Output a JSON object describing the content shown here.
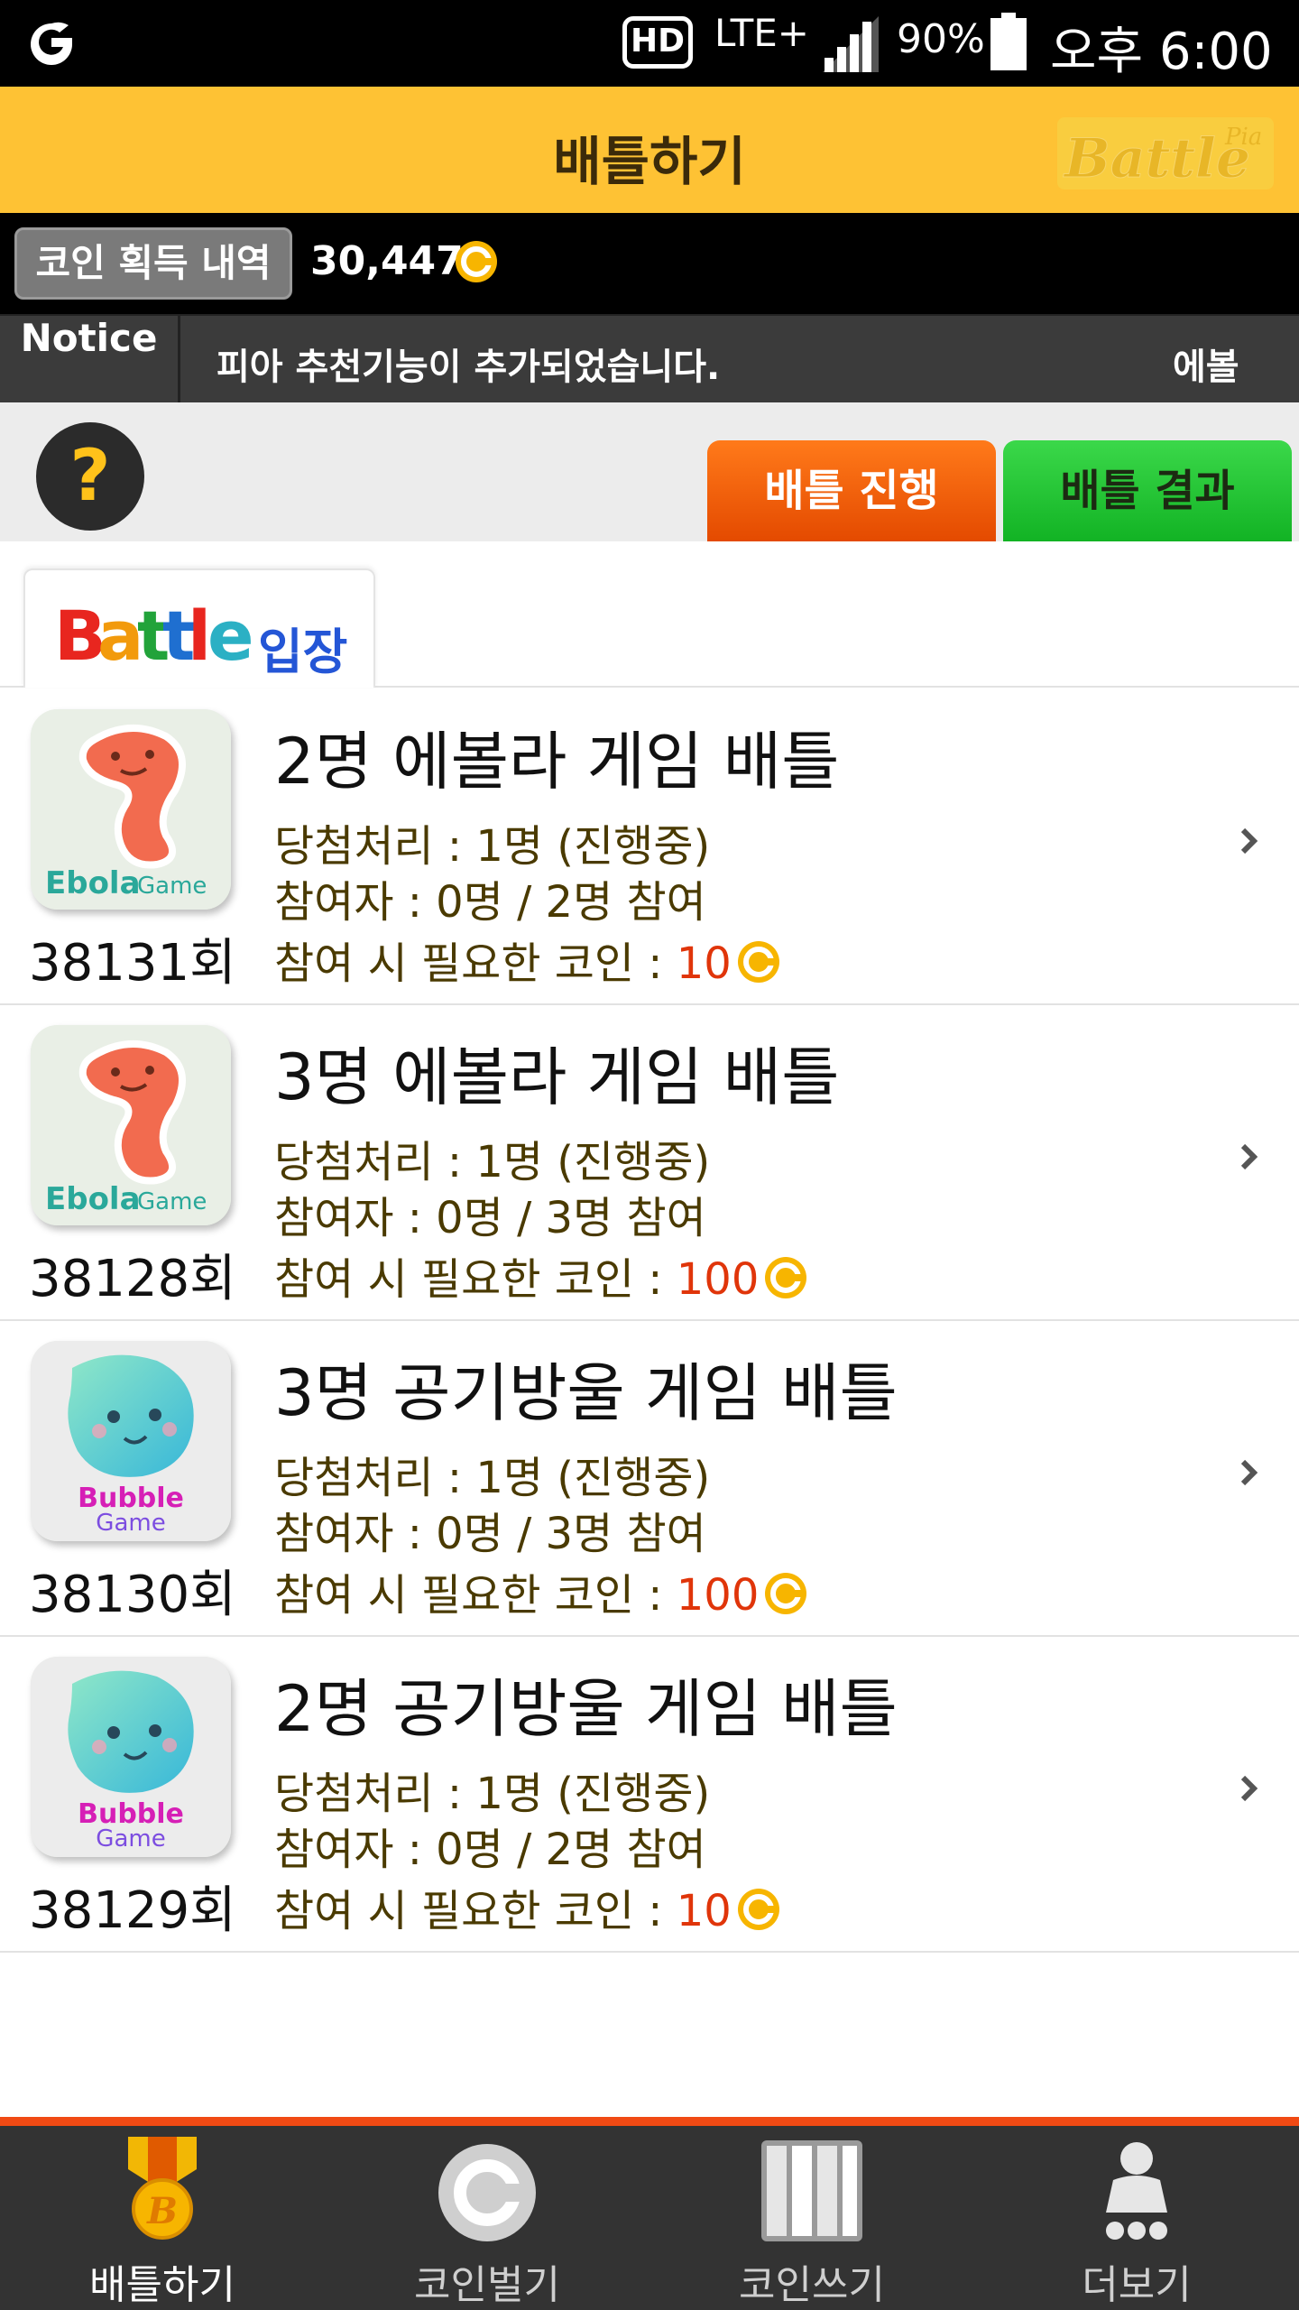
{
  "status_bar": {
    "hd": "HD",
    "network": "LTE+",
    "battery_percent": "90%",
    "time": "오후 6:00"
  },
  "header": {
    "title": "배틀하기",
    "logo_text": "Battle",
    "logo_sup": "Pia"
  },
  "coins": {
    "history_label": "코인 획득 내역",
    "amount": "30,447"
  },
  "notice": {
    "label": "Notice",
    "text": "피아 추천기능이 추가되었습니다.",
    "text_next": "에볼"
  },
  "tabs": {
    "progress_label": "배틀 진행",
    "result_label": "배틀 결과"
  },
  "entry": {
    "battle_letters": [
      "B",
      "a",
      "t",
      "t",
      "l",
      "e"
    ],
    "battle_colors": [
      "#e8261f",
      "#f29a0c",
      "#22a33a",
      "#1f6fd0",
      "#e8261f",
      "#2bb0c4"
    ],
    "suffix": "입장"
  },
  "battles": [
    {
      "game": "ebola",
      "icon_caption_1": "Ebola",
      "icon_caption_2": "Game",
      "round": "38131회",
      "title": "2명 에볼라 게임 배틀",
      "winner_line": "당첨처리 : 1명  (진행중)",
      "participants_line": "참여자 : 0명 / 2명 참여",
      "cost_label": "참여 시 필요한 코인 : ",
      "cost_value": "10"
    },
    {
      "game": "ebola",
      "icon_caption_1": "Ebola",
      "icon_caption_2": "Game",
      "round": "38128회",
      "title": "3명 에볼라 게임 배틀",
      "winner_line": "당첨처리 : 1명  (진행중)",
      "participants_line": "참여자 : 0명 / 3명 참여",
      "cost_label": "참여 시 필요한 코인 : ",
      "cost_value": "100"
    },
    {
      "game": "bubble",
      "icon_caption_1": "Bubble",
      "icon_caption_2": "Game",
      "round": "38130회",
      "title": "3명 공기방울 게임 배틀",
      "winner_line": "당첨처리 : 1명  (진행중)",
      "participants_line": "참여자 : 0명 / 3명 참여",
      "cost_label": "참여 시 필요한 코인 : ",
      "cost_value": "100"
    },
    {
      "game": "bubble",
      "icon_caption_1": "Bubble",
      "icon_caption_2": "Game",
      "round": "38129회",
      "title": "2명 공기방울 게임 배틀",
      "winner_line": "당첨처리 : 1명  (진행중)",
      "participants_line": "참여자 : 0명 / 2명 참여",
      "cost_label": "참여 시 필요한 코인 : ",
      "cost_value": "10"
    }
  ],
  "bottom_nav": [
    {
      "label": "배틀하기",
      "icon": "medal-icon",
      "active": true
    },
    {
      "label": "코인벌기",
      "icon": "coin-icon",
      "active": false
    },
    {
      "label": "코인쓰기",
      "icon": "bars-icon",
      "active": false
    },
    {
      "label": "더보기",
      "icon": "person-icon",
      "active": false
    }
  ],
  "colors": {
    "header_bg": "#fec234",
    "tab_progress": "#f05a0a",
    "tab_result": "#22c232",
    "cost": "#e0350a",
    "nav_accent": "#f04a14",
    "coin": "#f7b500"
  }
}
